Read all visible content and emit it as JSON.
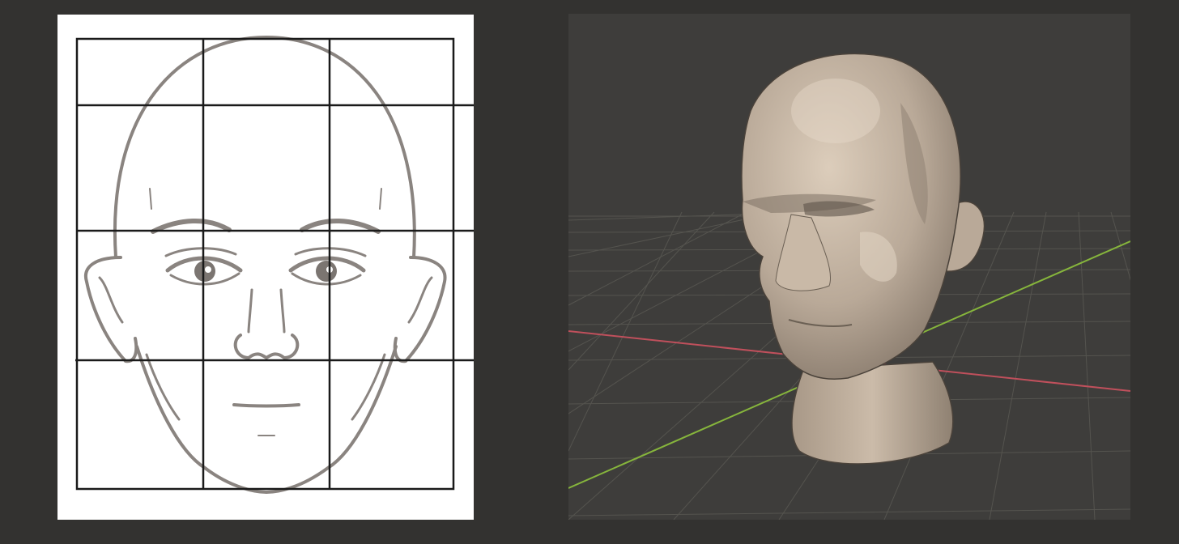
{
  "reference_sketch": {
    "description_icon": "face-proportion-grid-icon",
    "grid_color": "#1a1a1a",
    "sketch_color": "#8a8480"
  },
  "viewport_3d": {
    "background_color": "#3e3d3b",
    "grid_line_color": "#5a5957",
    "x_axis_color": "#c0505c",
    "y_axis_color": "#86b53c",
    "model_color": "#c2b3a2"
  }
}
